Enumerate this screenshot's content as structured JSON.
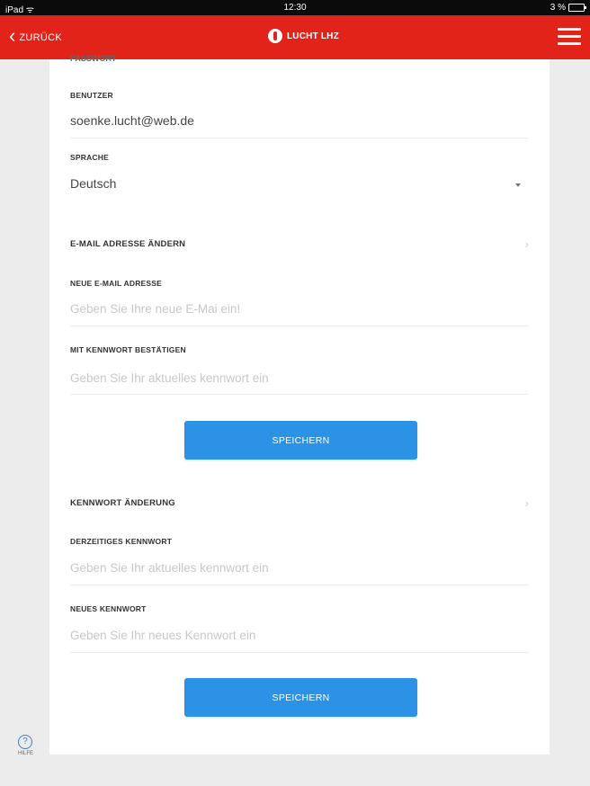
{
  "status_bar": {
    "carrier": "iPad ᯤ",
    "time": "12:30",
    "battery": "3 %"
  },
  "nav": {
    "back_label": "ZURÜCK",
    "logo_text": "LUCHT LHZ"
  },
  "account": {
    "scrolled_label": "PASSWORT",
    "user_label": "BENUTZER",
    "user_value": "soenke.lucht@web.de",
    "language_label": "SPRACHE",
    "language_value": "Deutsch"
  },
  "email_section": {
    "title": "E-MAIL ADRESSE ÄNDERN",
    "new_email_label": "NEUE E-MAIL ADRESSE",
    "new_email_placeholder": "Geben Sie Ihre neue E-Mai ein!",
    "confirm_label": "MIT KENNWORT BESTÄTIGEN",
    "confirm_placeholder": "Geben Sie Ihr aktuelles kennwort ein",
    "save_label": "SPEICHERN"
  },
  "password_section": {
    "title": "KENNWORT ÄNDERUNG",
    "current_label": "DERZEITIGES KENNWORT",
    "current_placeholder": "Geben Sie Ihr aktuelles kennwort ein",
    "new_label": "NEUES KENNWORT",
    "new_placeholder": "Geben Sie Ihr neues Kennwort ein",
    "save_label": "SPEICHERN"
  },
  "help": {
    "icon": "help-icon",
    "label": "HILFE"
  },
  "colors": {
    "nav_red": "#e2231a",
    "button_blue": "#2b92e6"
  }
}
